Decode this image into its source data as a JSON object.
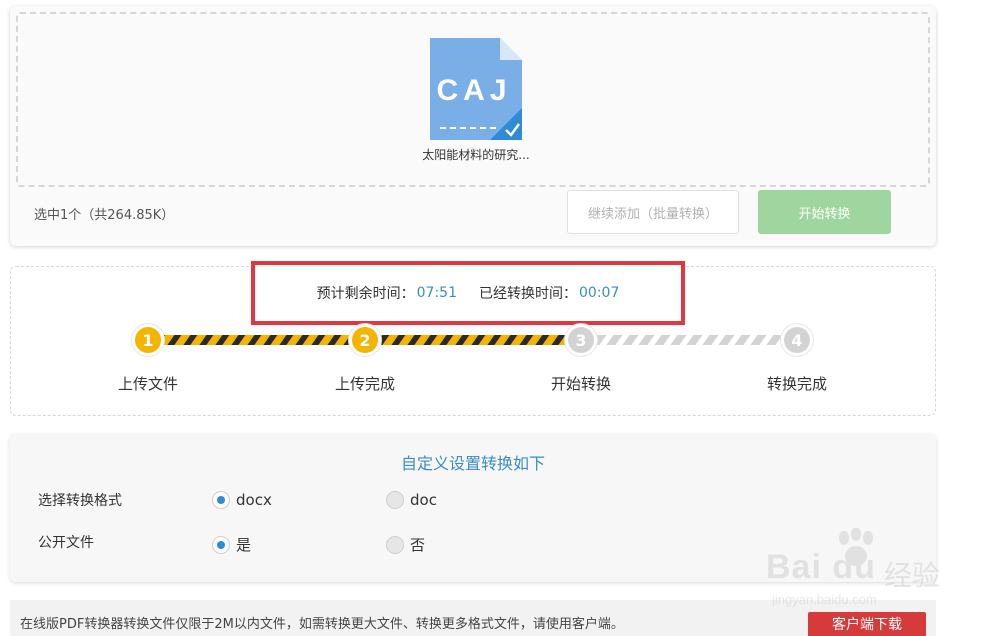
{
  "upload": {
    "file_badge": "CAJ",
    "file_name": "太阳能材料的研究...",
    "selected_info": "选中1个（共264.85K）",
    "add_button": "继续添加（批量转换）",
    "start_button": "开始转换"
  },
  "progress": {
    "remaining_label": "预计剩余时间：",
    "remaining_value": "07:51",
    "elapsed_label": "已经转换时间：",
    "elapsed_value": "00:07",
    "steps": [
      {
        "number": "1",
        "label": "上传文件",
        "state": "done"
      },
      {
        "number": "2",
        "label": "上传完成",
        "state": "done"
      },
      {
        "number": "3",
        "label": "开始转换",
        "state": "todo"
      },
      {
        "number": "4",
        "label": "转换完成",
        "state": "todo"
      }
    ],
    "colors": {
      "done": "#f4b400",
      "todo": "#d3d3d3",
      "highlight_box": "#e0383e"
    }
  },
  "settings": {
    "title": "自定义设置转换如下",
    "format_label": "选择转换格式",
    "format_options": [
      {
        "label": "docx",
        "selected": true
      },
      {
        "label": "doc",
        "selected": false
      }
    ],
    "public_label": "公开文件",
    "public_options": [
      {
        "label": "是",
        "selected": true
      },
      {
        "label": "否",
        "selected": false
      }
    ]
  },
  "notice": {
    "text": "在线版PDF转换器转换文件仅限于2M以内文件，如需转换更大文件、转换更多格式文件，请使用客户端。",
    "client_button": "客户端下载"
  },
  "watermark": {
    "brand": "Bai du",
    "brand_cn": "经验",
    "url": "jingyan.baidu.com"
  }
}
